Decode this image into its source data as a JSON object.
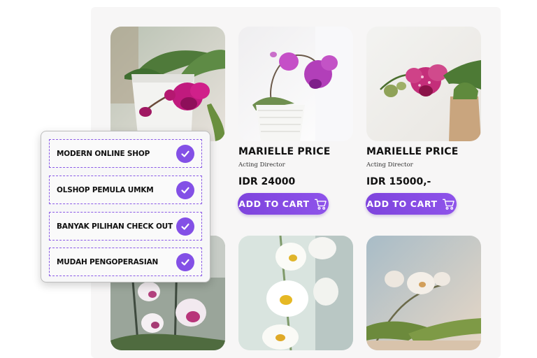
{
  "products": [
    {
      "name": "MARIELLE PRICE",
      "role": "Acting Director",
      "price": "IDR 24000",
      "cta": "ADD TO CART"
    },
    {
      "name": "MARIELLE PRICE",
      "role": "Acting Director",
      "price": "IDR 15000,-",
      "cta": "ADD TO CART"
    }
  ],
  "features": [
    {
      "label": "MODERN ONLINE SHOP"
    },
    {
      "label": "OLSHOP PEMULA UMKM"
    },
    {
      "label": "BANYAK PILIHAN CHECK OUT"
    },
    {
      "label": "MUDAH PENGOPERASIAN"
    }
  ],
  "colors": {
    "accent": "#8350e6",
    "button": "#7e44dd",
    "panel": "#f7f6f6"
  },
  "icons": {
    "cart": "shopping-cart-icon",
    "check": "check-circle-icon"
  }
}
